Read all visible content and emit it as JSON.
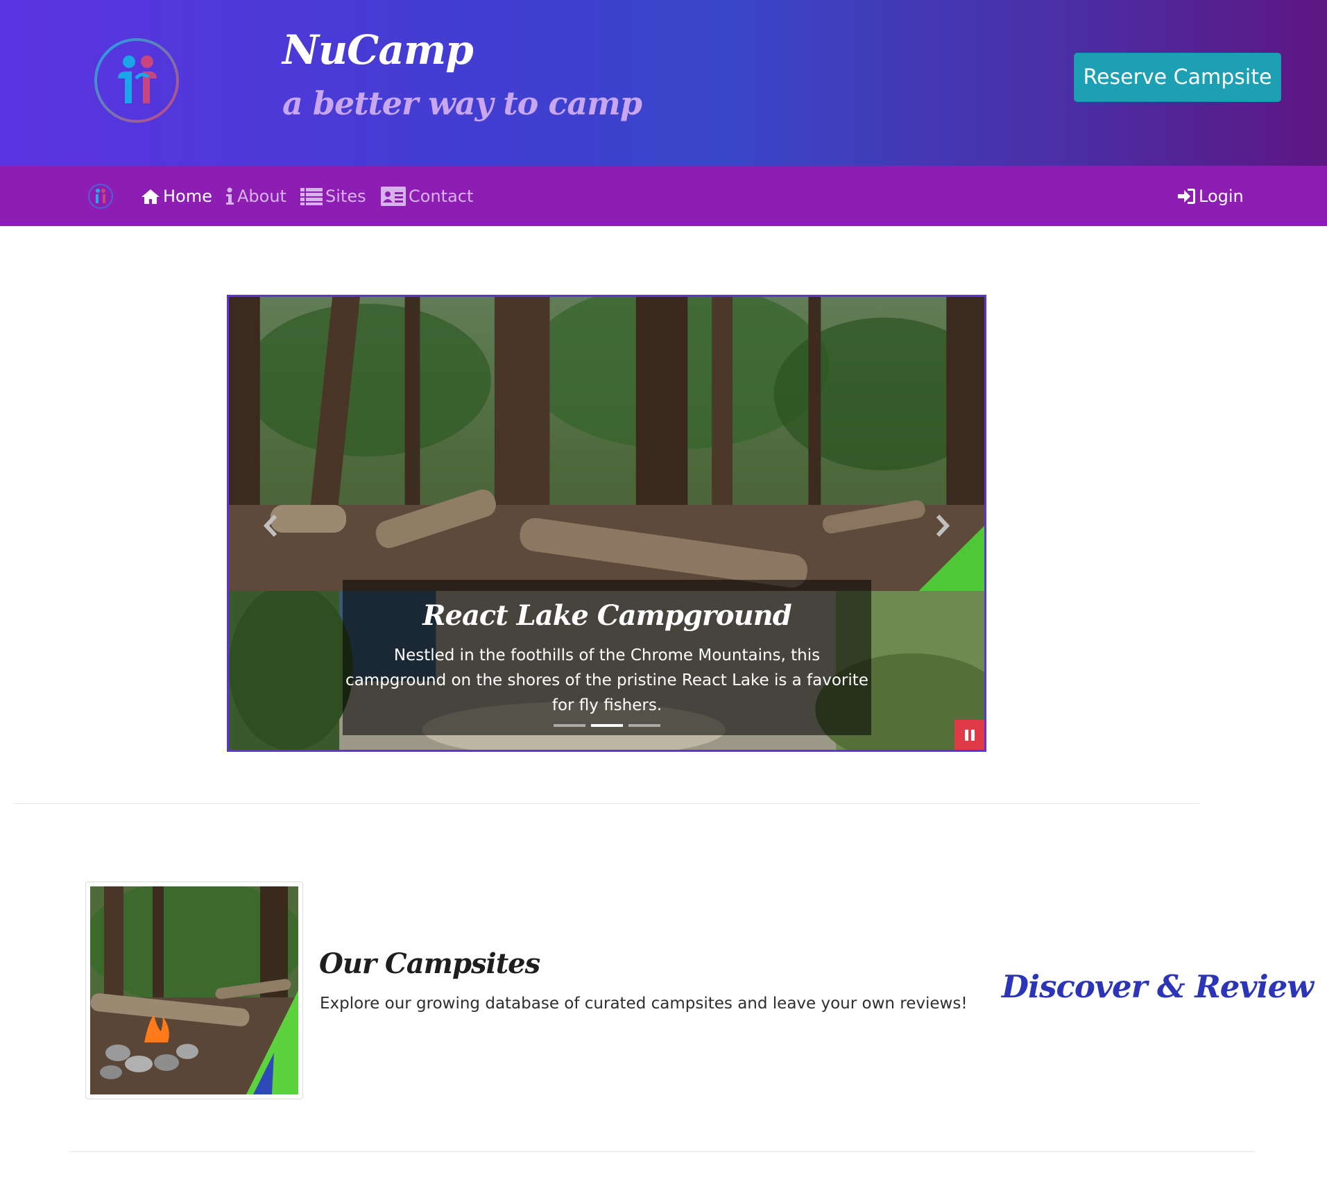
{
  "header": {
    "brand_title": "NuCamp",
    "tagline": "a better way to camp",
    "reserve_label": "Reserve Campsite",
    "logo_icon": "nucamp-logo-icon"
  },
  "navbar": {
    "items": [
      {
        "label": "Home",
        "icon": "home-icon"
      },
      {
        "label": "About",
        "icon": "info-icon"
      },
      {
        "label": "Sites",
        "icon": "list-icon"
      },
      {
        "label": "Contact",
        "icon": "address-card-icon"
      }
    ],
    "login_label": "Login",
    "active_item": "Home"
  },
  "carousel": {
    "caption_title": "React Lake Campground",
    "caption_text": "Nestled in the foothills of the Chrome Mountains, this campground on the shores of the pristine React Lake is a favorite for fly fishers.",
    "slide_count": 3,
    "active_index": 1,
    "paused_icon": "pause-icon"
  },
  "media": {
    "title": "Our Campsites",
    "text": "Explore our growing database of curated campsites and leave your own reviews!",
    "tagline": "Discover & Review"
  },
  "colors": {
    "header_gradient_start": "#5b33e0",
    "header_gradient_end": "#5e1682",
    "navbar": "#8e1db3",
    "reserve_button": "#1d9fb4",
    "pause_button": "#e03a48",
    "accent_text": "#2c35b8"
  }
}
